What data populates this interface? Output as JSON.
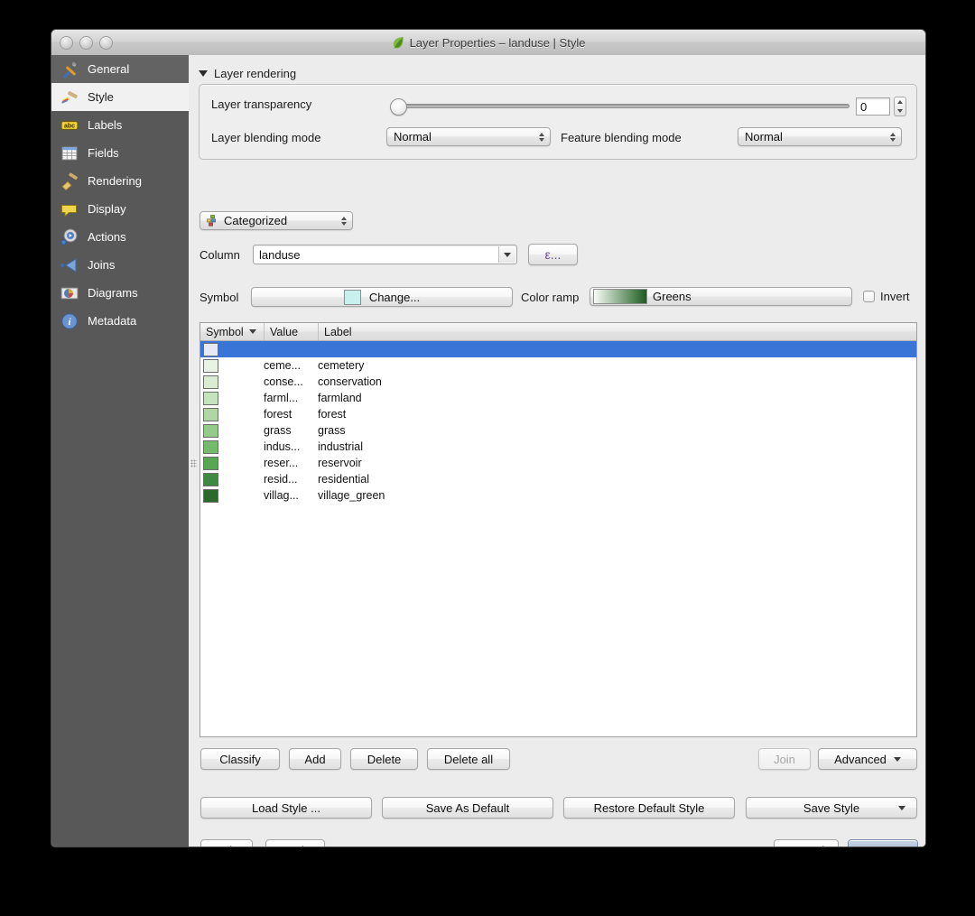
{
  "window": {
    "title": "Layer Properties – landuse | Style",
    "app_icon": "qgis-leaf-icon",
    "traffic_lights": [
      "close-button",
      "minimize-button",
      "zoom-button"
    ]
  },
  "sidebar": {
    "items": [
      {
        "label": "General",
        "icon": "hammer-wrench-icon",
        "selected": false,
        "hovered": true
      },
      {
        "label": "Style",
        "icon": "paintbrush-icon",
        "selected": true,
        "hovered": false
      },
      {
        "label": "Labels",
        "icon": "abc-label-icon",
        "selected": false,
        "hovered": false
      },
      {
        "label": "Fields",
        "icon": "table-grid-icon",
        "selected": false,
        "hovered": false
      },
      {
        "label": "Rendering",
        "icon": "broom-icon",
        "selected": false,
        "hovered": false
      },
      {
        "label": "Display",
        "icon": "speech-bubble-icon",
        "selected": false,
        "hovered": false
      },
      {
        "label": "Actions",
        "icon": "gear-play-icon",
        "selected": false,
        "hovered": false
      },
      {
        "label": "Joins",
        "icon": "join-arrow-icon",
        "selected": false,
        "hovered": false
      },
      {
        "label": "Diagrams",
        "icon": "pie-chart-icon",
        "selected": false,
        "hovered": false
      },
      {
        "label": "Metadata",
        "icon": "info-circle-icon",
        "selected": false,
        "hovered": false
      }
    ]
  },
  "layer_rendering": {
    "group_label": "Layer rendering",
    "expanded": true,
    "transparency": {
      "label": "Layer transparency",
      "value": "0",
      "slider_min": 0,
      "slider_max": 100,
      "slider_position": 0
    },
    "layer_blending": {
      "label": "Layer blending mode",
      "value": "Normal"
    },
    "feature_blending": {
      "label": "Feature blending mode",
      "value": "Normal"
    }
  },
  "renderer": {
    "type_value": "Categorized",
    "type_icon": "categorized-icon",
    "column_label": "Column",
    "column_value": "landuse",
    "expression_button_label": "ε...",
    "symbol_label": "Symbol",
    "symbol_change_label": "Change...",
    "symbol_color": "#c7f0ee",
    "color_ramp_label": "Color ramp",
    "color_ramp_value": "Greens",
    "color_ramp_start": "#f7fcf5",
    "color_ramp_end": "#1d5c20",
    "invert_label": "Invert",
    "invert_checked": false
  },
  "table": {
    "headers": {
      "symbol": "Symbol",
      "value": "Value",
      "label": "Label",
      "sorted_column": "symbol",
      "sort_direction": "descending"
    },
    "rows": [
      {
        "color": "#e3eaf5",
        "value": "",
        "label": "",
        "selected": true
      },
      {
        "color": "#e8f3e4",
        "value": "ceme...",
        "label": "cemetery",
        "selected": false
      },
      {
        "color": "#d9ecd2",
        "value": "conse...",
        "label": "conservation",
        "selected": false
      },
      {
        "color": "#c5e4bb",
        "value": "farml...",
        "label": "farmland",
        "selected": false
      },
      {
        "color": "#aed7a3",
        "value": "forest",
        "label": "forest",
        "selected": false
      },
      {
        "color": "#94cb8a",
        "value": "grass",
        "label": "grass",
        "selected": false
      },
      {
        "color": "#74bb6c",
        "value": "indus...",
        "label": "industrial",
        "selected": false
      },
      {
        "color": "#57a755",
        "value": "reser...",
        "label": "reservoir",
        "selected": false
      },
      {
        "color": "#3e8a43",
        "value": "resid...",
        "label": "residential",
        "selected": false
      },
      {
        "color": "#2a6b2d",
        "value": "villag...",
        "label": "village_green",
        "selected": false
      }
    ]
  },
  "actions": {
    "classify": "Classify",
    "add": "Add",
    "delete": "Delete",
    "delete_all": "Delete all",
    "join": "Join",
    "join_disabled": true,
    "advanced": "Advanced"
  },
  "style_actions": {
    "load_style": "Load Style ...",
    "save_as_default": "Save As Default",
    "restore_default": "Restore Default Style",
    "save_style": "Save Style"
  },
  "dialog_buttons": {
    "help": "Help",
    "apply": "Apply",
    "cancel": "Cancel",
    "ok": "OK",
    "default_button": "OK"
  }
}
